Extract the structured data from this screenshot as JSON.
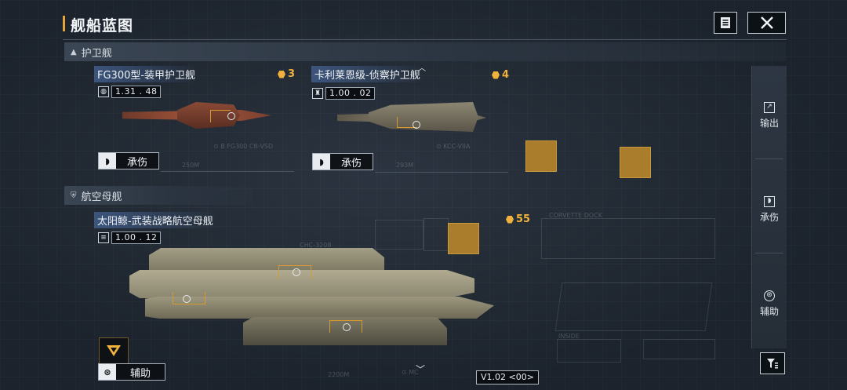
{
  "header": {
    "title": "舰船蓝图",
    "notes_icon": "document-icon",
    "close_icon": "close-icon"
  },
  "sections": {
    "frigate": {
      "label": "护卫舰",
      "icon": "triangle-icon"
    },
    "carrier": {
      "label": "航空母舰",
      "icon": "carrier-icon"
    }
  },
  "ships": {
    "fg300": {
      "name": "FG300型-装甲护卫舰",
      "cost": "3",
      "version_icon": "globe-icon",
      "version": "1.31 . 48",
      "role": "承伤",
      "role_icon": "shield-icon"
    },
    "kalilaien": {
      "name": "卡利莱恩级-侦察护卫舰",
      "cost": "4",
      "version_icon": "tower-icon",
      "version": "1.00 . 02",
      "role": "承伤",
      "role_icon": "shield-icon"
    },
    "sunwhale": {
      "name": "太阳鲸-武装战略航空母舰",
      "cost": "55",
      "version_icon": "brand-icon",
      "version": "1.00 . 12",
      "role": "辅助",
      "role_icon": "support-icon"
    }
  },
  "blueprint_texts": {
    "fg300_code": "⊙ B FG300 CB-VSD",
    "fg300_len": "250M",
    "kali_code": "⊙ KCC-VIIA",
    "kali_len": "293M",
    "sun_code": "CHC-3208",
    "sun_len": "2200M",
    "sun_mc": "⊙ MC",
    "corvette": "CORVETTE DOCK",
    "inside": "INSIDE",
    "version_footer": "V1.02 <00>"
  },
  "right_panel": {
    "export": {
      "label": "输出",
      "icon": "export-arrow-icon"
    },
    "tank": {
      "label": "承伤",
      "icon": "shield-icon"
    },
    "support": {
      "label": "辅助",
      "icon": "support-icon"
    },
    "filter_icon": "filter-icon"
  },
  "colors": {
    "accent": "#f0b23c",
    "slot": "#b8862a",
    "highlight": "#4664a0"
  }
}
